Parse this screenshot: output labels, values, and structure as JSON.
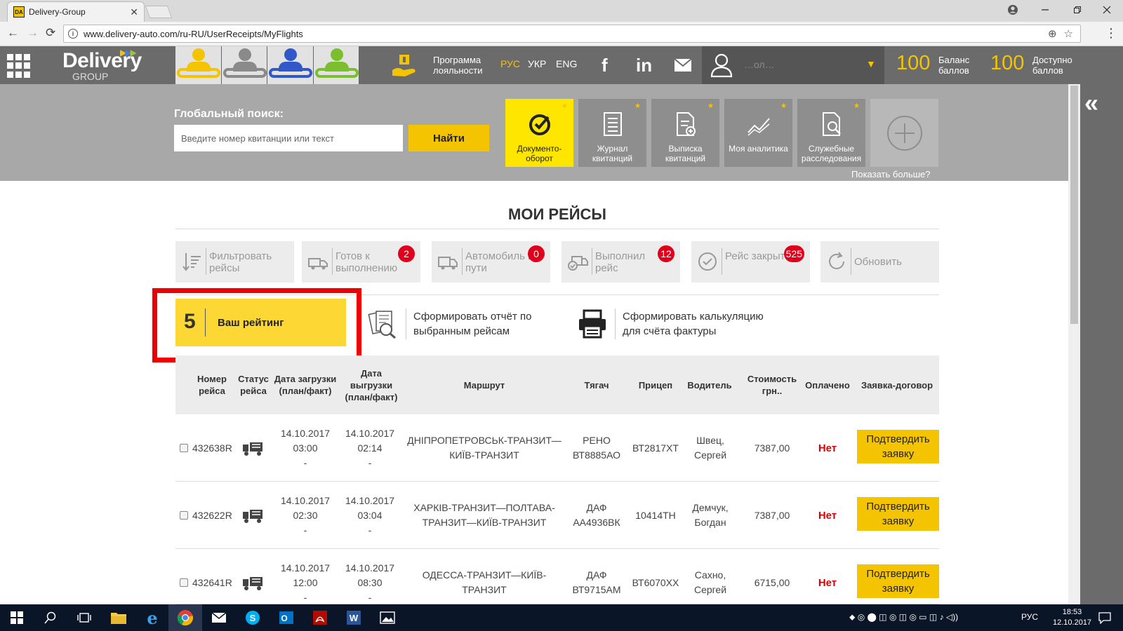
{
  "browser": {
    "tab_title": "Delivery-Group",
    "tab_close": "✕",
    "favicon_text": "DA",
    "url": "www.delivery-auto.com/ru-RU/UserReceipts/MyFlights",
    "window_controls": [
      "account-icon",
      "minimize",
      "maximize",
      "close"
    ]
  },
  "header": {
    "logo_top": "Delivery",
    "logo_bottom": "GROUP",
    "loyalty_label": "Программа лояльности",
    "languages": [
      "РУС",
      "УКР",
      "ENG"
    ],
    "active_language": "РУС",
    "social": [
      "facebook-icon",
      "linkedin-icon",
      "mail-icon"
    ],
    "user_name": "…ол…",
    "balance_points": "100",
    "balance_label": "Баланс баллов",
    "available_points": "100",
    "available_label": "Доступно баллов",
    "accent_color": "#f5c400"
  },
  "search": {
    "label": "Глобальный поиск:",
    "placeholder": "Введите номер квитанции или текст",
    "button": "Найти"
  },
  "tiles": [
    {
      "label": "Документо-оборот",
      "icon": "check-circle-icon",
      "active": true
    },
    {
      "label": "Журнал квитанций",
      "icon": "journal-icon",
      "active": false
    },
    {
      "label": "Выписка квитанций",
      "icon": "receipt-add-icon",
      "active": false
    },
    {
      "label": "Моя аналитика",
      "icon": "analytics-icon",
      "active": false
    },
    {
      "label": "Служебные расследования",
      "icon": "investigation-icon",
      "active": false
    }
  ],
  "show_more": "Показать больше?",
  "page_title": "МОИ РЕЙСЫ",
  "filters": [
    {
      "label": "Фильтровать рейсы",
      "badge": ""
    },
    {
      "label": "Готов к выполнению",
      "badge": "2"
    },
    {
      "label": "Автомобиль в пути",
      "badge": "0"
    },
    {
      "label": "Выполнил рейс",
      "badge": "12"
    },
    {
      "label": "Рейс закрыт",
      "badge": "525"
    },
    {
      "label": "Обновить",
      "badge": ""
    }
  ],
  "rating": {
    "value": "5",
    "label": "Ваш рейтинг"
  },
  "actions": {
    "report": "Сформировать отчёт по выбранным рейсам",
    "calc": "Сформировать калькуляцию для счёта фактуры"
  },
  "table": {
    "headers": [
      "Номер рейса",
      "Статус рейса",
      "Дата загрузки (план/факт)",
      "Дата выгрузки (план/факт)",
      "Маршрут",
      "Тягач",
      "Прицеп",
      "Водитель",
      "Стоимость грн..",
      "Оплачено",
      "Заявка-договор"
    ],
    "rows": [
      {
        "number": "432638R",
        "load_date": "14.10.2017",
        "load_time": "03:00",
        "load_fact": "-",
        "unload_date": "14.10.2017",
        "unload_time": "02:14",
        "unload_fact": "-",
        "route": "ДНІПРОПЕТРОВСЬК-ТРАНЗИТ—КИЇВ-ТРАНЗИТ",
        "truck": "РЕНО ВТ8885АО",
        "trailer": "ВТ2817ХТ",
        "driver": "Швец, Сергей",
        "cost": "7387,00",
        "paid": "Нет",
        "action": "Подтвердить заявку"
      },
      {
        "number": "432622R",
        "load_date": "14.10.2017",
        "load_time": "02:30",
        "load_fact": "-",
        "unload_date": "14.10.2017",
        "unload_time": "03:04",
        "unload_fact": "-",
        "route": "ХАРКІВ-ТРАНЗИТ—ПОЛТАВА-ТРАНЗИТ—КИЇВ-ТРАНЗИТ",
        "truck": "ДАФ АА4936ВК",
        "trailer": "10414ТН",
        "driver": "Демчук, Богдан",
        "cost": "7387,00",
        "paid": "Нет",
        "action": "Подтвердить заявку"
      },
      {
        "number": "432641R",
        "load_date": "14.10.2017",
        "load_time": "12:00",
        "load_fact": "-",
        "unload_date": "14.10.2017",
        "unload_time": "08:30",
        "unload_fact": "-",
        "route": "ОДЕССА-ТРАНЗИТ—КИЇВ-ТРАНЗИТ",
        "truck": "ДАФ ВТ9715АМ",
        "trailer": "ВТ6070ХХ",
        "driver": "Сахно, Сергей",
        "cost": "6715,00",
        "paid": "Нет",
        "action": "Подтвердить заявку"
      }
    ]
  },
  "taskbar": {
    "lang": "РУС",
    "time": "18:53",
    "date": "12.10.2017"
  }
}
